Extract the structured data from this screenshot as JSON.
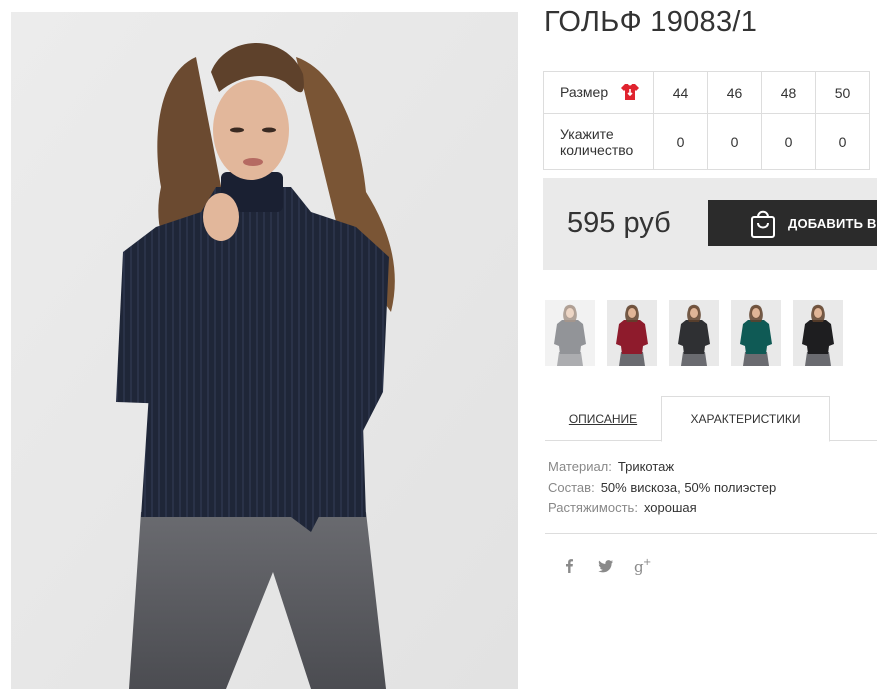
{
  "product": {
    "title": "ГОЛЬФ 19083/1",
    "price": "595 руб",
    "add_to_cart_label": "ДОБАВИТЬ В КОРЗИНУ"
  },
  "size_table": {
    "size_label": "Размер",
    "qty_label_line1": "Укажите",
    "qty_label_line2": "количество",
    "sizes": [
      "44",
      "46",
      "48",
      "50"
    ],
    "quantities": [
      "0",
      "0",
      "0",
      "0"
    ]
  },
  "thumbnails": [
    {
      "color": "#3a3d45",
      "selected": true
    },
    {
      "color": "#8e1b2c",
      "selected": false
    },
    {
      "color": "#2f3033",
      "selected": false
    },
    {
      "color": "#0f5a55",
      "selected": false
    },
    {
      "color": "#1e1e20",
      "selected": false
    }
  ],
  "tabs": {
    "description": "ОПИСАНИЕ",
    "characteristics": "ХАРАКТЕРИСТИКИ"
  },
  "properties": [
    {
      "key": "Материал:",
      "value": "Трикотаж"
    },
    {
      "key": "Состав:",
      "value": "50% вискоза, 50% полиэстер"
    },
    {
      "key": "Растяжимость:",
      "value": "хорошая"
    }
  ],
  "social": [
    "facebook-icon",
    "twitter-icon",
    "google-plus-icon"
  ],
  "colors": {
    "button_bg": "#2b2b2b",
    "price_box_bg": "#eaeaea",
    "sweater": "#1f2638",
    "jeans": "#5a5b60",
    "size_icon": "#e0232e"
  }
}
